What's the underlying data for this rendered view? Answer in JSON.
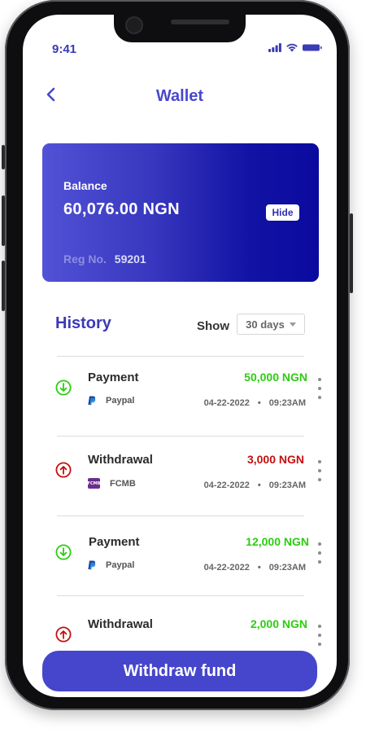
{
  "status_bar": {
    "time": "9:41"
  },
  "header": {
    "title": "Wallet"
  },
  "card": {
    "balance_label": "Balance",
    "balance_value": "60,076.00 NGN",
    "hide_label": "Hide",
    "reg_label": "Reg No.",
    "reg_value": "59201"
  },
  "history": {
    "title": "History",
    "show_label": "Show",
    "range_selected": "30 days",
    "items": [
      {
        "type": "Payment",
        "amount": "50,000 NGN",
        "direction": "in",
        "method": "Paypal",
        "method_icon": "paypal-icon",
        "date": "04-22-2022",
        "sep": "•",
        "time": "09:23AM"
      },
      {
        "type": "Withdrawal",
        "amount": "3,000 NGN",
        "direction": "out",
        "method": "FCMB",
        "method_icon": "fcmb-logo",
        "logo_text": "FCMB",
        "date": "04-22-2022",
        "sep": "•",
        "time": "09:23AM"
      },
      {
        "type": "Payment",
        "amount": "12,000 NGN",
        "direction": "in",
        "method": "Paypal",
        "method_icon": "paypal-icon",
        "date": "04-22-2022",
        "sep": "•",
        "time": "09:23AM"
      },
      {
        "type": "Withdrawal",
        "amount": "2,000 NGN",
        "direction": "out",
        "method": "",
        "method_icon": "",
        "date": "",
        "sep": "",
        "time": ""
      }
    ]
  },
  "footer": {
    "withdraw_label": "Withdraw fund"
  },
  "colors": {
    "accent": "#4646cc",
    "incoming": "#2ecc12",
    "outgoing": "#c40f0f",
    "card_start": "#5252d6",
    "card_end": "#0a0aa0"
  }
}
